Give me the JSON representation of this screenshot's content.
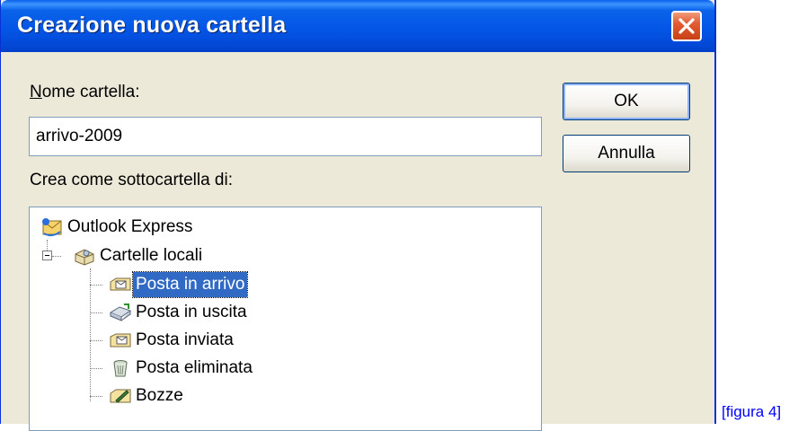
{
  "dialog": {
    "title": "Creazione nuova cartella",
    "name_label_first": "N",
    "name_label_rest": "ome cartella:",
    "name_value": "arrivo-2009",
    "parent_label": "Crea come sottocartella di:",
    "ok_label": "OK",
    "cancel_label": "Annulla"
  },
  "tree": {
    "root": {
      "label": "Outlook Express",
      "icon": "outlook-express-icon"
    },
    "local": {
      "label": "Cartelle locali",
      "icon": "local-folders-icon"
    },
    "items": [
      {
        "label": "Posta in arrivo",
        "icon": "inbox-icon",
        "selected": true
      },
      {
        "label": "Posta in uscita",
        "icon": "outbox-icon",
        "selected": false
      },
      {
        "label": "Posta inviata",
        "icon": "sent-items-icon",
        "selected": false
      },
      {
        "label": "Posta eliminata",
        "icon": "deleted-items-icon",
        "selected": false
      },
      {
        "label": "Bozze",
        "icon": "drafts-icon",
        "selected": false
      }
    ]
  },
  "caption": "[figura 4]",
  "colors": {
    "titlebar": "#0456e6",
    "dialog_bg": "#ece9d8",
    "selection": "#316ac5",
    "caption": "#0000ff"
  }
}
